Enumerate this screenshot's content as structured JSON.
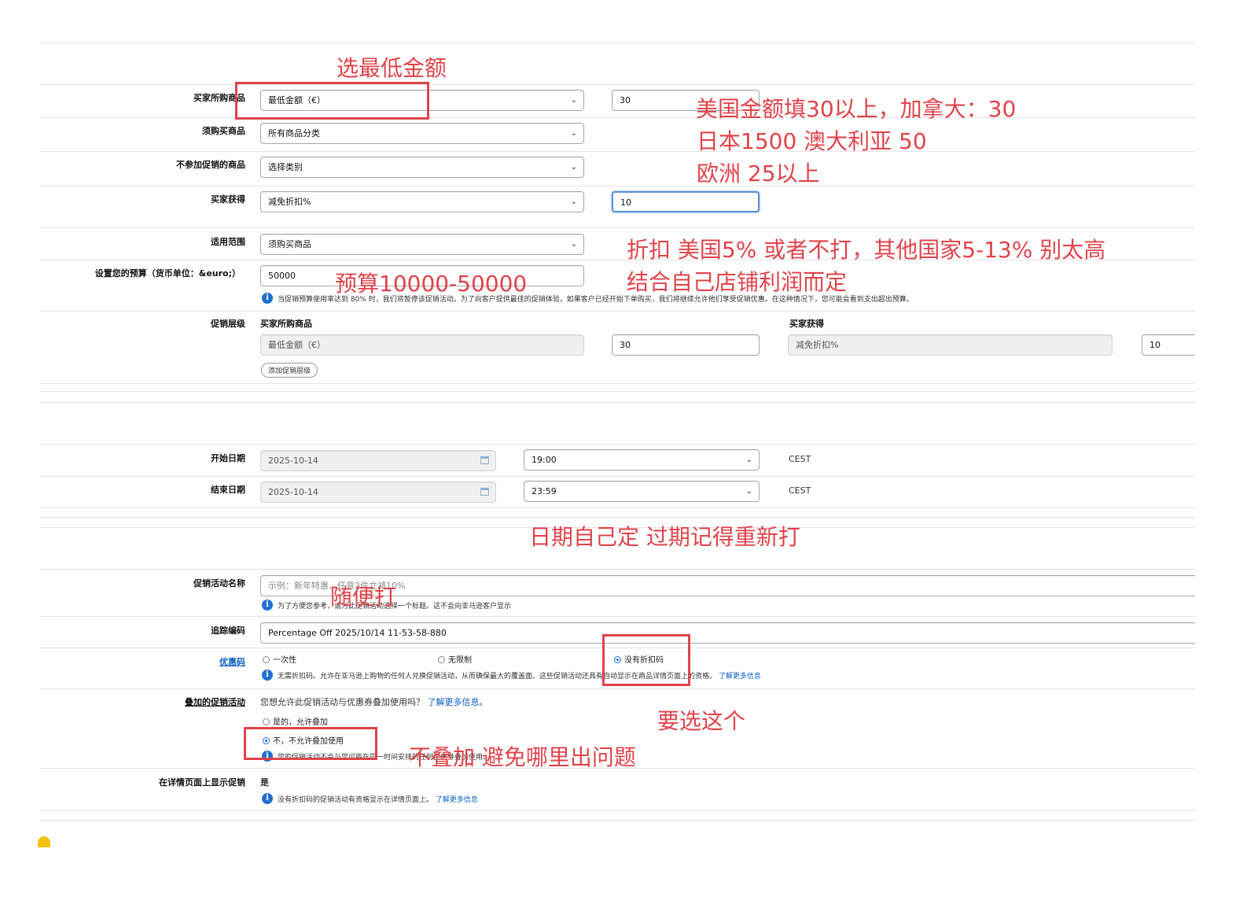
{
  "form": {
    "buyer_purchases": {
      "label": "买家所购商品",
      "value": "最低金额（€）",
      "amount": "30"
    },
    "purchased_items": {
      "label": "须购买商品",
      "value": "所有商品分类"
    },
    "excluded_items": {
      "label": "不参加促销的商品",
      "value": "选择类别"
    },
    "buyer_gets": {
      "label": "买家获得",
      "value": "减免折扣%",
      "amount": "10"
    },
    "scope": {
      "label": "适用范围",
      "value": "须购买商品"
    },
    "budget": {
      "label": "设置您的预算（货币单位：&euro;）",
      "value": "50000",
      "note": "当促销预算使用率达到 80% 时，我们将暂停该促销活动。为了向客户提供最佳的促销体验，如果客户已经开始下单购买，我们将继续允许他们享受促销优惠。在这种情况下，您可能会看到支出超出预算。"
    },
    "tiers": {
      "label": "促销层级",
      "col_buy": "买家所购商品",
      "col_get": "买家获得",
      "buy_value": "最低金额（€）",
      "buy_amount": "30",
      "get_value": "减免折扣%",
      "get_amount": "10",
      "add_button": "添加促销层级"
    },
    "start_date": {
      "label": "开始日期",
      "date": "2025-10-14",
      "time": "19:00",
      "tz": "CEST"
    },
    "end_date": {
      "label": "结束日期",
      "date": "2025-10-14",
      "time": "23:59",
      "tz": "CEST"
    },
    "promo_name": {
      "label": "促销活动名称",
      "placeholder": "示例：新年特惠，任意2件立减10%",
      "note": "为了方便您参考，请为此促销活动选择一个标题。这不会向亚马逊客户显示"
    },
    "tracking": {
      "label": "追踪编码",
      "value": "Percentage Off 2025/10/14 11-53-58-880"
    },
    "coupon": {
      "label": "优惠码",
      "opt1": "一次性",
      "opt2": "无限制",
      "opt3": "没有折扣码",
      "note": "无需折扣码。允许在亚马逊上购物的任何人兑换促销活动，从而确保最大的覆盖面。这些促销活动还具有自动显示在商品详情页面上的资格。",
      "link": "了解更多信息"
    },
    "stacking": {
      "label": "叠加的促销活动",
      "question": "您想允许此促销活动与优惠券叠加使用吗？",
      "link": "了解更多信息。",
      "opt_yes": "是的，允许叠加",
      "opt_no": "不，不允许叠加使用",
      "note": "您的促销活动不会与您可能在同一时间安排的任何优惠券叠加使用。"
    },
    "detail_page": {
      "label": "在详情页面上显示促销",
      "value": "是",
      "note": "没有折扣码的促销活动有资格显示在详情页面上。",
      "link": "了解更多信息"
    }
  },
  "annotations": {
    "a1": "选最低金额",
    "a2": "美国金额填30以上，加拿大：30",
    "a3": "日本1500  澳大利亚 50",
    "a4": "欧洲 25以上",
    "a5": "折扣 美国5% 或者不打，其他国家5-13% 别太高",
    "a6": "结合自己店铺利润而定",
    "a7": "预算10000-50000",
    "a8": "日期自己定 过期记得重新打",
    "a9": "随便打",
    "a10": "要选这个",
    "a11": "不叠加 避免哪里出问题"
  },
  "colors": {
    "annotation_red": "#e0434b",
    "link_blue": "#0b5fbf",
    "info_blue": "#1f6fd1"
  }
}
